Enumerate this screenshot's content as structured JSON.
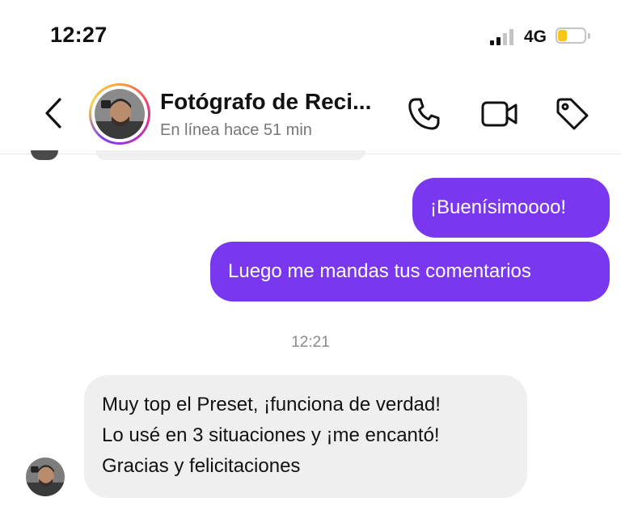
{
  "status_bar": {
    "time": "12:27",
    "network": "4G",
    "battery_level": 0.35,
    "battery_color": "#f5c518"
  },
  "header": {
    "contact_name": "Fotógrafo de Reci...",
    "status": "En línea hace 51 min",
    "icons": [
      "chevron-left-icon",
      "phone-icon",
      "video-camera-icon",
      "tag-icon"
    ]
  },
  "messages": {
    "outgoing": [
      {
        "text": "¡Buenísimoooo!"
      },
      {
        "text": "Luego me mandas tus comentarios"
      }
    ],
    "timestamp": "12:21",
    "incoming": {
      "lines": [
        "Muy top el Preset, ¡funciona de verdad!",
        "Lo usé en 3 situaciones y ¡me encantó!",
        "Gracias y felicitaciones"
      ]
    }
  },
  "colors": {
    "outgoing_bubble": "#7a37f0",
    "incoming_bubble": "#efefef",
    "secondary_text": "#777777"
  }
}
